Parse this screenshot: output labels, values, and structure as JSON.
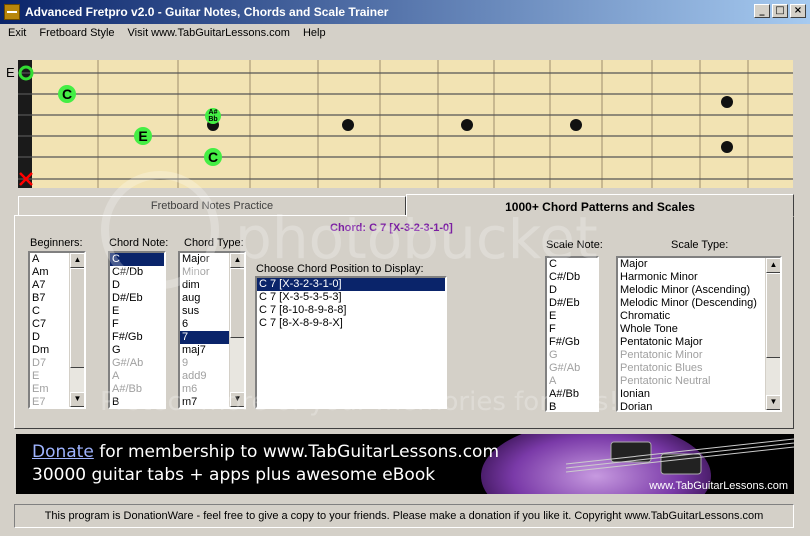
{
  "window": {
    "title": "Advanced Fretpro v2.0 - Guitar Notes, Chords and Scale Trainer",
    "buttons": [
      "_",
      "□",
      "×"
    ]
  },
  "menu": [
    "Exit",
    "Fretboard Style",
    "Visit www.TabGuitarLessons.com",
    "Help"
  ],
  "fretboard": {
    "string_label": "E",
    "notes": [
      "C",
      "E",
      "C"
    ],
    "fingering_note": "A#\nBb",
    "colors": {
      "wood": "#f2e3b3",
      "marker": "#44ee44",
      "nut": "#1a1a1a",
      "mute": "#ff0000"
    }
  },
  "tabs": {
    "fretboard_notes": "Fretboard Notes Practice",
    "chords_scales": "1000+ Chord Patterns and Scales"
  },
  "chord_display": "Chord: C 7 [X-3-2-3-1-0]",
  "beginners": {
    "label": "Beginners:",
    "items": [
      "A",
      "Am",
      "A7",
      "B7",
      "C",
      "C7",
      "D",
      "Dm",
      "D7",
      "E",
      "Em",
      "E7"
    ]
  },
  "chord_note": {
    "label": "Chord Note:",
    "items": [
      "C",
      "C#/Db",
      "D",
      "D#/Eb",
      "E",
      "F",
      "F#/Gb",
      "G",
      "G#/Ab",
      "A",
      "A#/Bb",
      "B"
    ]
  },
  "chord_type": {
    "label": "Chord Type:",
    "items": [
      "Major",
      "Minor",
      "dim",
      "aug",
      "sus",
      "6",
      "7",
      "maj7",
      "9",
      "add9",
      "m6",
      "m7"
    ],
    "selected": "7"
  },
  "chord_position": {
    "label": "Choose Chord Position to Display:",
    "items": [
      "C 7 [X-3-2-3-1-0]",
      "C 7 [X-3-5-3-5-3]",
      "C 7 [8-10-8-9-8-8]",
      "C 7 [8-X-8-9-8-X]"
    ],
    "selected": "C 7 [X-3-2-3-1-0]"
  },
  "scale_note": {
    "label": "Scale Note:",
    "items": [
      "C",
      "C#/Db",
      "D",
      "D#/Eb",
      "E",
      "F",
      "F#/Gb",
      "G",
      "G#/Ab",
      "A",
      "A#/Bb",
      "B"
    ]
  },
  "scale_type": {
    "label": "Scale Type:",
    "items": [
      "Major",
      "Harmonic Minor",
      "Melodic Minor (Ascending)",
      "Melodic Minor (Descending)",
      "Chromatic",
      "Whole Tone",
      "Pentatonic Major",
      "Pentatonic Minor",
      "Pentatonic Blues",
      "Pentatonic Neutral",
      "Ionian",
      "Dorian"
    ]
  },
  "banner": {
    "donate": "Donate",
    "line1_rest": " for membership to www.TabGuitarLessons.com",
    "line2": "30000 guitar tabs + apps plus awesome eBook",
    "site": "www.TabGuitarLessons.com"
  },
  "status": "This program is DonationWare - feel free to give a copy to your friends. Please make a donation if you like it. Copyright www.TabGuitarLessons.com",
  "watermark": "Protect more of your memories for less!"
}
